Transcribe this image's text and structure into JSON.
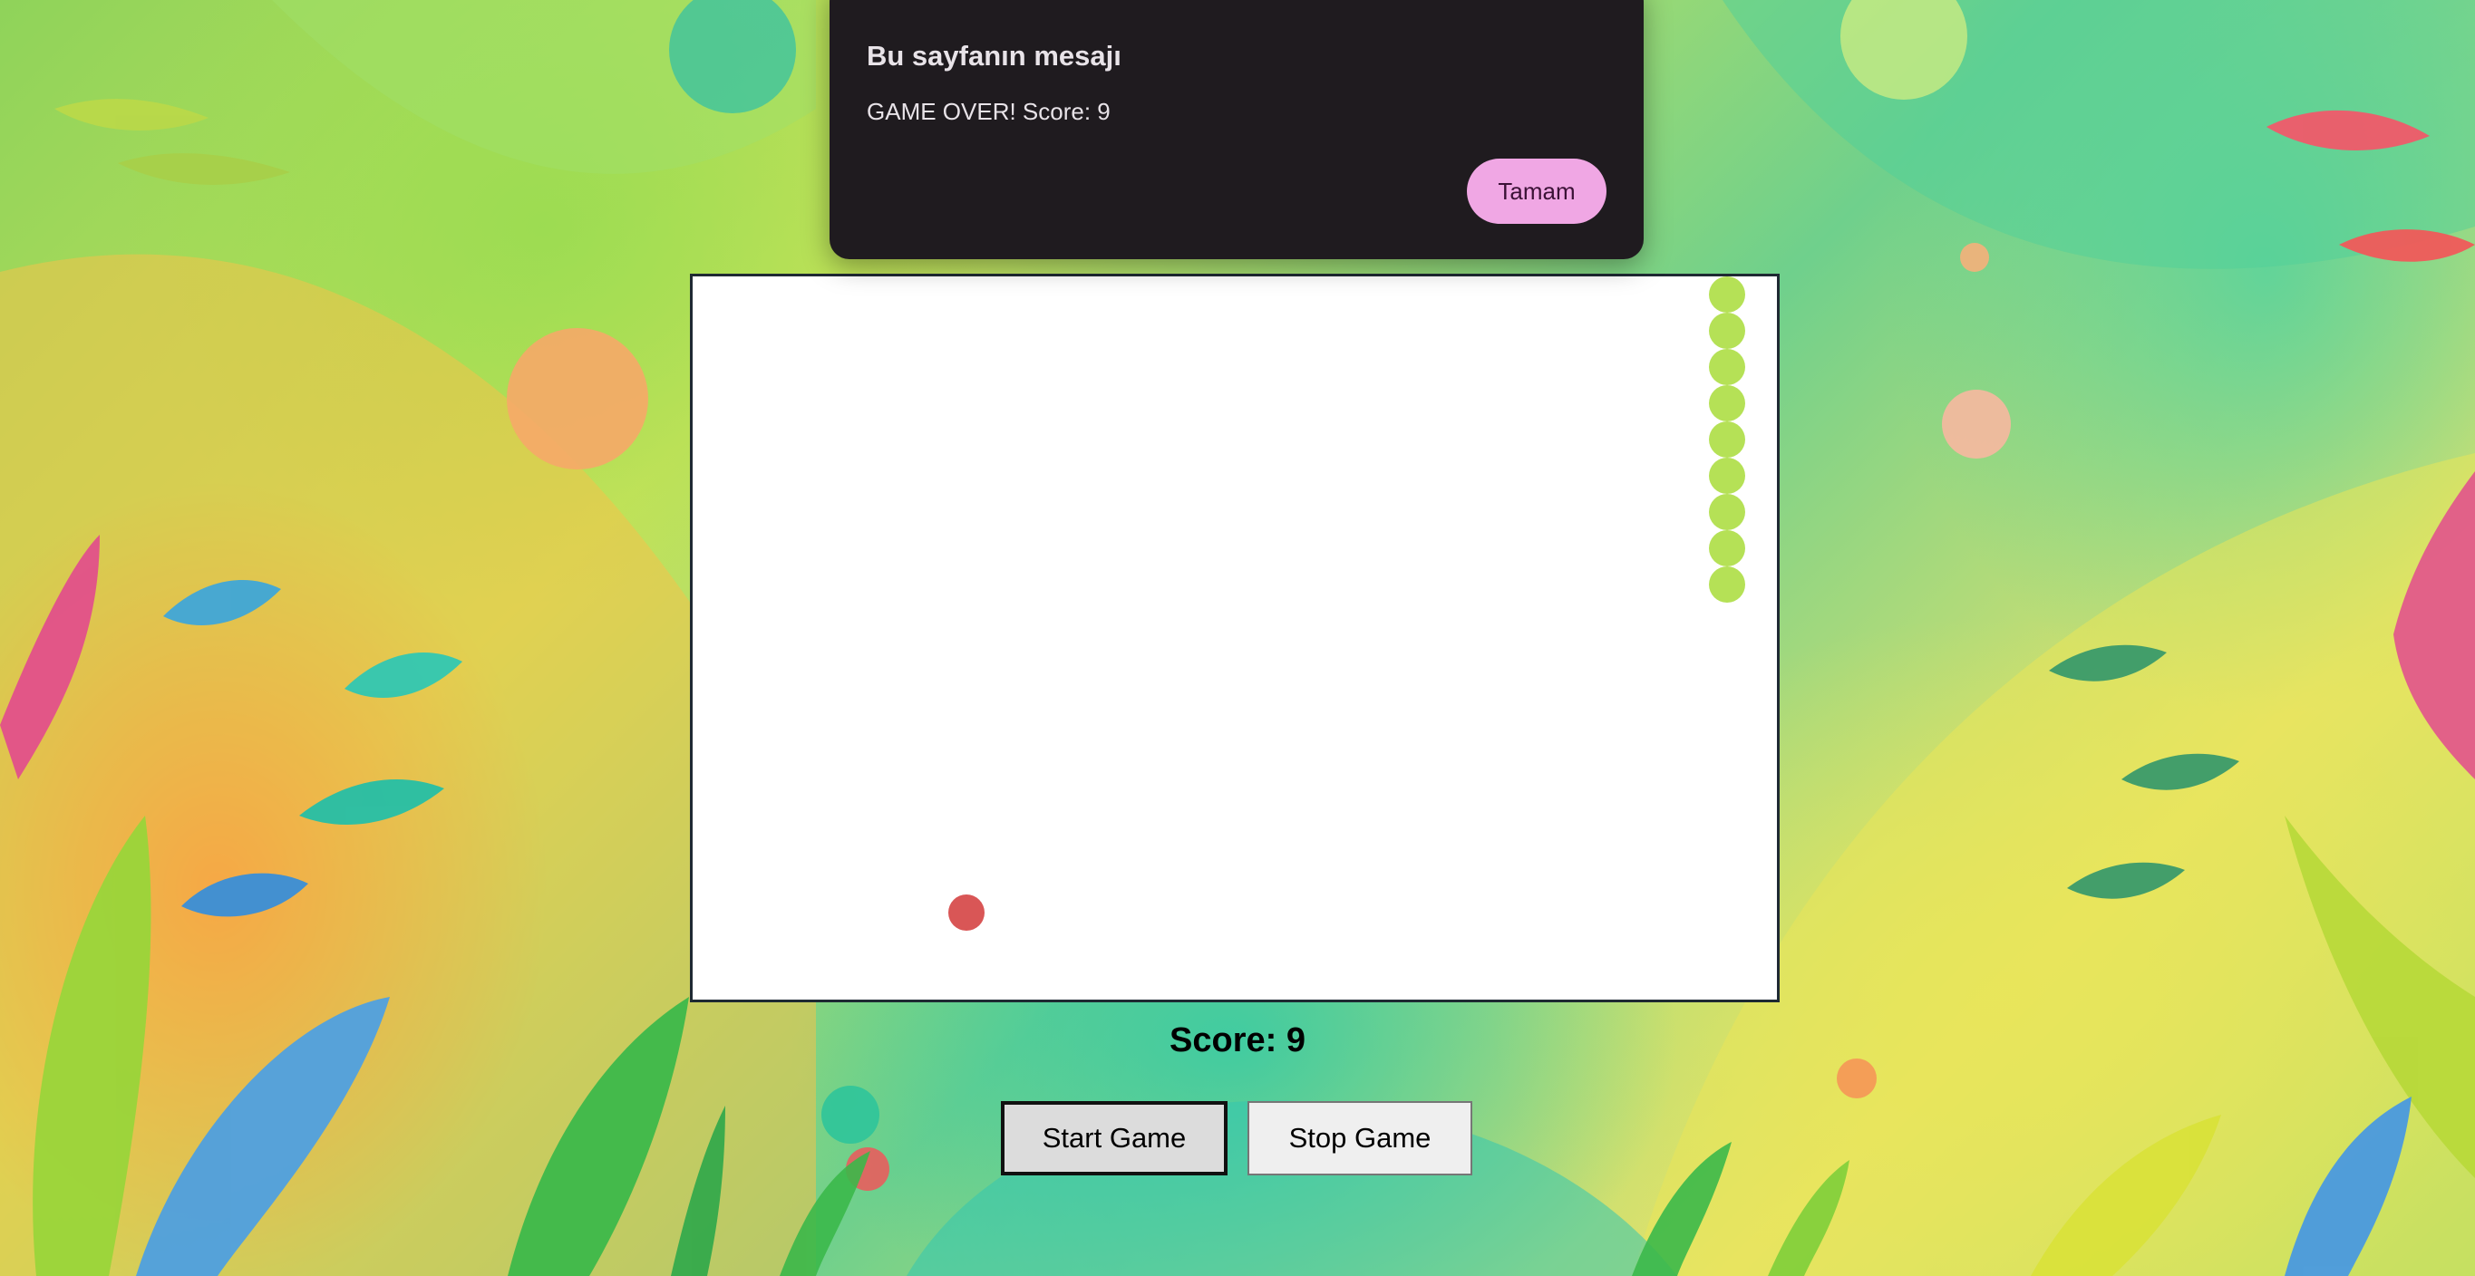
{
  "dialog": {
    "title": "Bu sayfanın mesajı",
    "message": "GAME OVER! Score: 9",
    "ok_label": "Tamam"
  },
  "game": {
    "score_label": "Score: 9",
    "score": 9,
    "snake_segments": 9,
    "snake_color": "#b5e156",
    "food_color": "#d95656"
  },
  "controls": {
    "start_label": "Start Game",
    "stop_label": "Stop Game"
  },
  "colors": {
    "board_background": "#ffffff",
    "board_border": "#1f2a33",
    "dialog_background": "#1f1b1f",
    "dialog_button": "#f0a7e4"
  }
}
